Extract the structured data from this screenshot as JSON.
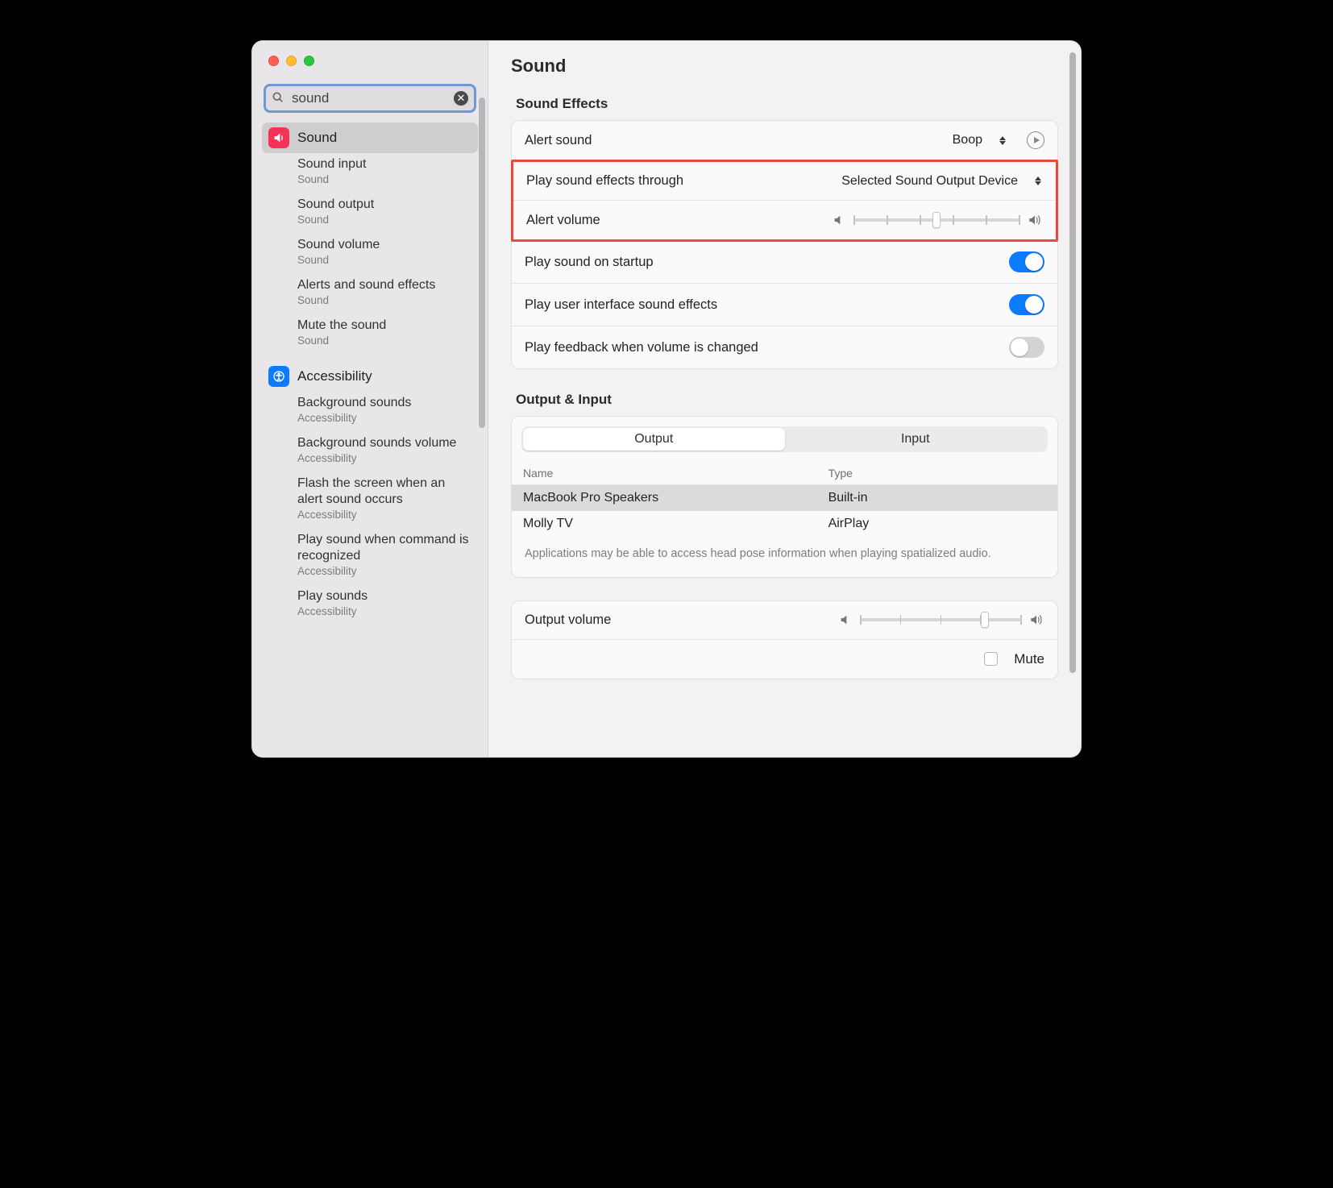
{
  "search": {
    "value": "sound"
  },
  "sidebar": {
    "primary": {
      "label": "Sound"
    },
    "results_sound": [
      {
        "title": "Sound input",
        "category": "Sound"
      },
      {
        "title": "Sound output",
        "category": "Sound"
      },
      {
        "title": "Sound volume",
        "category": "Sound"
      },
      {
        "title": "Alerts and sound effects",
        "category": "Sound"
      },
      {
        "title": "Mute the sound",
        "category": "Sound"
      }
    ],
    "accessibility": {
      "label": "Accessibility"
    },
    "results_access": [
      {
        "title": "Background sounds",
        "category": "Accessibility"
      },
      {
        "title": "Background sounds volume",
        "category": "Accessibility"
      },
      {
        "title": "Flash the screen when an alert sound occurs",
        "category": "Accessibility"
      },
      {
        "title": "Play sound when command is recognized",
        "category": "Accessibility"
      },
      {
        "title": "Play sounds",
        "category": "Accessibility"
      }
    ]
  },
  "page": {
    "title": "Sound",
    "sections": {
      "effects_title": "Sound Effects",
      "alert_sound_label": "Alert sound",
      "alert_sound_value": "Boop",
      "play_through_label": "Play sound effects through",
      "play_through_value": "Selected Sound Output Device",
      "alert_volume_label": "Alert volume",
      "alert_volume_percent": 50,
      "startup_label": "Play sound on startup",
      "startup_on": true,
      "ui_sounds_label": "Play user interface sound effects",
      "ui_sounds_on": true,
      "feedback_label": "Play feedback when volume is changed",
      "feedback_on": false,
      "io_title": "Output & Input",
      "seg_output": "Output",
      "seg_input": "Input",
      "col_name": "Name",
      "col_type": "Type",
      "devices": [
        {
          "name": "MacBook Pro Speakers",
          "type": "Built-in",
          "selected": true
        },
        {
          "name": "Molly TV",
          "type": "AirPlay",
          "selected": false
        }
      ],
      "spatial_note": "Applications may be able to access head pose information when playing spatialized audio.",
      "output_volume_label": "Output volume",
      "output_volume_percent": 78,
      "mute_label": "Mute",
      "mute_on": false
    }
  }
}
